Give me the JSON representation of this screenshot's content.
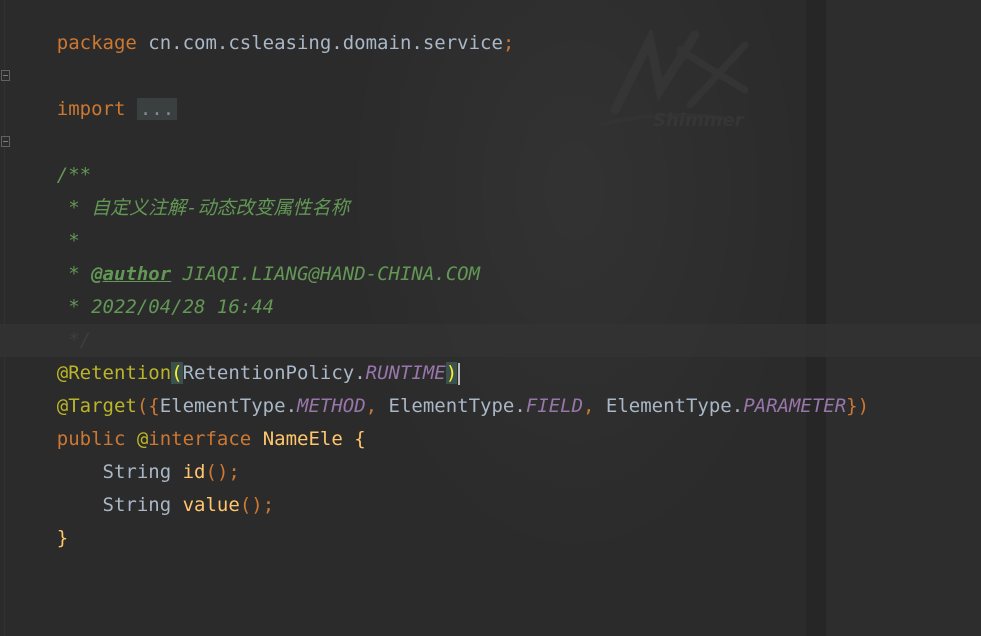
{
  "code": {
    "l1": {
      "kw": "package",
      "rest": " cn.com.csleasing.domain.service",
      "semi": ";"
    },
    "l2": {
      "kw": "import",
      "fold": "..."
    },
    "l3": {
      "open": "/**"
    },
    "l4": {
      "text": " * 自定义注解-动态改变属性名称"
    },
    "l5": {
      "text": " *"
    },
    "l6": {
      "prefix": " * ",
      "tag": "@author",
      "value": " JIAQI.LIANG@HAND-CHINA.COM"
    },
    "l7": {
      "text": " * 2022/04/28 16:44"
    },
    "l8": {
      "text": " */"
    },
    "l9": {
      "ann": "@Retention",
      "lp": "(",
      "cls": "RetentionPolicy.",
      "field": "RUNTIME",
      "rp": ")"
    },
    "l10": {
      "ann": "@Target",
      "open": "({",
      "t1": "ElementType.",
      "f1": "METHOD",
      "c1": ", ",
      "t2": "ElementType.",
      "f2": "FIELD",
      "c2": ", ",
      "t3": "ElementType.",
      "f3": "PARAMETER",
      "close": "})"
    },
    "l11": {
      "kw1": "public",
      "ann": " @",
      "kw2": "interface",
      "name": " NameEle",
      "brace": " {"
    },
    "l12": {
      "type": "    String ",
      "method": "id",
      "call": "();"
    },
    "l13": {
      "type": "    String ",
      "method": "value",
      "call": "();"
    },
    "l14": {
      "brace": "}"
    }
  },
  "watermark": {
    "text": "Shimmer"
  }
}
